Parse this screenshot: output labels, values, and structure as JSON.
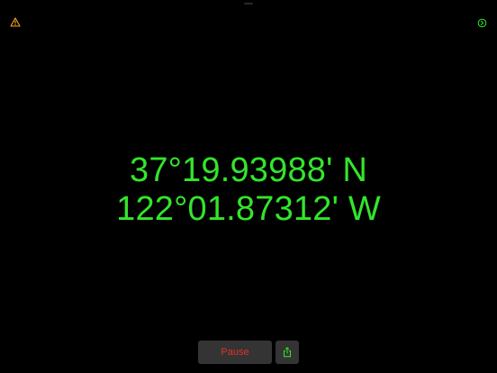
{
  "toolbar": {
    "warning_icon": "warning-triangle-icon",
    "warning_color": "#f5a623",
    "settings_icon": "settings-icon",
    "settings_color": "#33e52b"
  },
  "coordinates": {
    "latitude": "37°19.93988' N",
    "longitude": "122°01.87312' W",
    "color": "#33e52b"
  },
  "controls": {
    "pause_label": "Pause",
    "pause_color": "#e0322b",
    "share_icon": "share-icon",
    "share_color": "#33e52b"
  }
}
